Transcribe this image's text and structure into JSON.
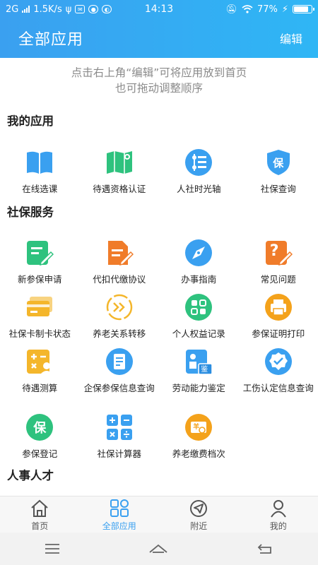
{
  "status": {
    "network": "2G",
    "speed": "1.5K/s",
    "time": "14:13",
    "battery": "77%"
  },
  "header": {
    "title": "全部应用",
    "edit": "编辑"
  },
  "hint": {
    "line1": "点击右上角“编辑”可将应用放到首页",
    "line2": "也可拖动调整顺序"
  },
  "sections": {
    "my_apps": "我的应用",
    "social": "社保服务",
    "hr": "人事人才"
  },
  "my_apps": [
    {
      "label": "在线选课"
    },
    {
      "label": "待遇资格认证"
    },
    {
      "label": "人社时光轴"
    },
    {
      "label": "社保查询"
    }
  ],
  "social": [
    {
      "label": "新参保申请"
    },
    {
      "label": "代扣代缴协议"
    },
    {
      "label": "办事指南"
    },
    {
      "label": "常见问题"
    },
    {
      "label": "社保卡制卡状态"
    },
    {
      "label": "养老关系转移"
    },
    {
      "label": "个人权益记录"
    },
    {
      "label": "参保证明打印"
    },
    {
      "label": "待遇测算"
    },
    {
      "label": "企保参保信息查询"
    },
    {
      "label": "劳动能力鉴定"
    },
    {
      "label": "工伤认定信息查询"
    },
    {
      "label": "参保登记"
    },
    {
      "label": "社保计算器"
    },
    {
      "label": "养老缴费档次"
    }
  ],
  "icon_text": {
    "bao": "保",
    "question": "?",
    "jian": "鉴",
    "yang": "羊"
  },
  "tabs": [
    {
      "label": "首页"
    },
    {
      "label": "全部应用"
    },
    {
      "label": "附近"
    },
    {
      "label": "我的"
    }
  ],
  "colors": {
    "brand": "#3aa0f0",
    "green": "#2ec27e",
    "orange": "#f07c2a",
    "yellow": "#f4b62b"
  }
}
